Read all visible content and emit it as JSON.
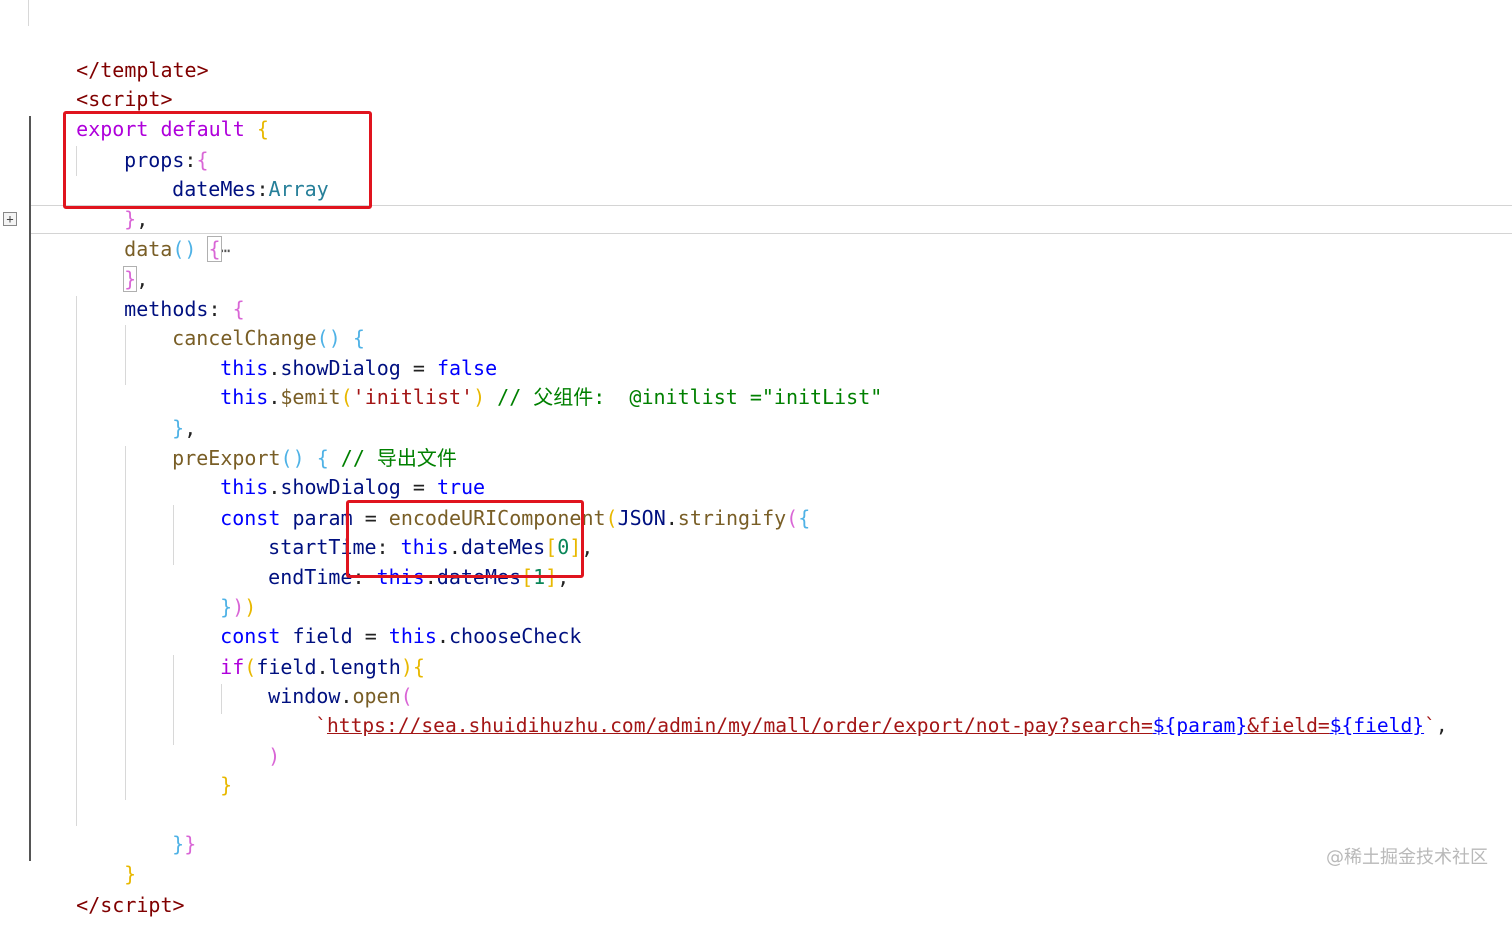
{
  "editor": {
    "fold_button": "+",
    "collapsed_ellipsis": "⋯",
    "lines": {
      "l1": {
        "open": "</",
        "name": "template",
        "close": ">"
      },
      "l2": {
        "open": "<",
        "name": "script",
        "close": ">"
      },
      "l3": {
        "kw1": "export",
        "kw2": "default",
        "brace": "{"
      },
      "l4": {
        "key": "props",
        "colon": ":",
        "brace": "{"
      },
      "l5": {
        "key": "dateMes",
        "colon": ":",
        "type": "Array"
      },
      "l6": {
        "brace": "}",
        "comma": ","
      },
      "l7": {
        "fn": "data",
        "parens": "()",
        "brace": "{"
      },
      "l8": {
        "brace": "}",
        "comma": ","
      },
      "l9": {
        "key": "methods",
        "colon": ": ",
        "brace": "{"
      },
      "l10": {
        "fn": "cancelChange",
        "parens": "()",
        "brace": "{"
      },
      "l11": {
        "this": "this",
        "dot": ".",
        "prop": "showDialog",
        "op": " = ",
        "val": "false"
      },
      "l12": {
        "this": "this",
        "dot": ".",
        "fn": "$emit",
        "po": "(",
        "str": "'initlist'",
        "pc": ")",
        "comment": "// 父组件:  @initlist =\"initList\""
      },
      "l13": {
        "brace": "}",
        "comma": ","
      },
      "l14": {
        "fn": "preExport",
        "parens": "()",
        "brace": "{",
        "comment": "// 导出文件"
      },
      "l15": {
        "this": "this",
        "dot": ".",
        "prop": "showDialog",
        "op": " = ",
        "val": "true"
      },
      "l16": {
        "kw": "const",
        "var": "param",
        "op": " = ",
        "fn1": "encodeURIComponent",
        "p1": "(",
        "obj": "JSON",
        "dot": ".",
        "fn2": "stringify",
        "p2": "(",
        "brace": "{"
      },
      "l17": {
        "key": "startTime",
        "colon": ": ",
        "this": "this",
        "dot": ".",
        "prop": "dateMes",
        "bo": "[",
        "num": "0",
        "bc": "]",
        "comma": ","
      },
      "l18": {
        "key": "endTime",
        "colon": ": ",
        "this": "this",
        "dot": ".",
        "prop": "dateMes",
        "bo": "[",
        "num": "1",
        "bc": "]",
        "comma": ","
      },
      "l19": {
        "brace": "}",
        "p2": ")",
        "p1": ")"
      },
      "l20": {
        "kw": "const",
        "var": "field",
        "op": " = ",
        "this": "this",
        "dot": ".",
        "prop": "chooseCheck"
      },
      "l21": {
        "kw": "if",
        "po": "(",
        "var": "field",
        "dot": ".",
        "prop": "length",
        "pc": ")",
        "brace": "{"
      },
      "l22": {
        "obj": "window",
        "dot": ".",
        "fn": "open",
        "po": "("
      },
      "l23": {
        "tick_open": "`",
        "url": "https://sea.shuidihuzhu.com/admin/my/mall/order/export/not-pay?search=",
        "tpl1": "${param}",
        "mid": "&field=",
        "tpl2": "${field}",
        "tick_close": "`",
        "comma": ","
      },
      "l24": {
        "pc": ")"
      },
      "l25": {
        "brace": "}"
      },
      "l27": {
        "b1": "}",
        "b2": "}"
      },
      "l28": {
        "brace": "}"
      },
      "l29": {
        "open": "</",
        "name": "script",
        "close": ">"
      }
    }
  },
  "colors": {
    "highlight_box": "#e0141e",
    "tag": "#800000",
    "keyword": "#af00db",
    "identifier": "#001080",
    "function": "#795e26",
    "type": "#267f99",
    "this": "#0000ff",
    "string": "#a31515",
    "number": "#098658",
    "comment": "#008000"
  },
  "watermark": "@稀土掘金技术社区"
}
